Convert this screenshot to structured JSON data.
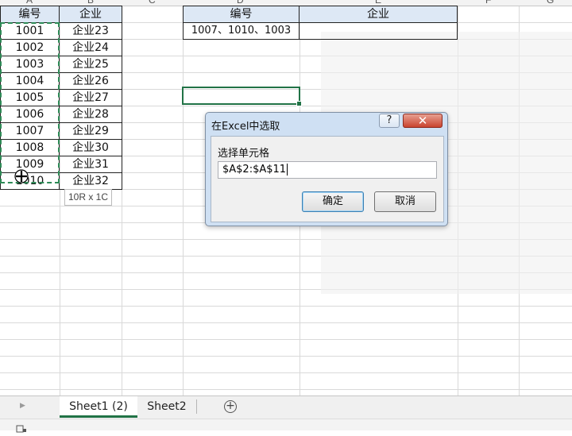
{
  "columns": [
    "A",
    "B",
    "C",
    "D",
    "E",
    "F",
    "G"
  ],
  "table1": {
    "headers": [
      "编号",
      "企业"
    ],
    "rows": [
      [
        "1001",
        "企业23"
      ],
      [
        "1002",
        "企业24"
      ],
      [
        "1003",
        "企业25"
      ],
      [
        "1004",
        "企业26"
      ],
      [
        "1005",
        "企业27"
      ],
      [
        "1006",
        "企业28"
      ],
      [
        "1007",
        "企业29"
      ],
      [
        "1008",
        "企业30"
      ],
      [
        "1009",
        "企业31"
      ],
      [
        "1010",
        "企业32"
      ]
    ]
  },
  "table2": {
    "headers": [
      "编号",
      "企业"
    ],
    "row": [
      "1007、1010、1003",
      ""
    ]
  },
  "selection_tooltip": "10R x 1C",
  "dialog": {
    "title": "在Excel中选取",
    "help_label": "?",
    "close_label": "✕",
    "field_label": "选择单元格",
    "input_value": "$A$2:$A$11",
    "ok_label": "确定",
    "cancel_label": "取消"
  },
  "sheet_tabs": [
    "Sheet1 (2)",
    "Sheet2"
  ],
  "active_tab": "Sheet1 (2)",
  "add_sheet_label": "+",
  "colors": {
    "header_fill": "#dde8f5",
    "selection_green": "#217346",
    "marching_ants": "#2e8b57",
    "close_red": "#c9432f"
  }
}
